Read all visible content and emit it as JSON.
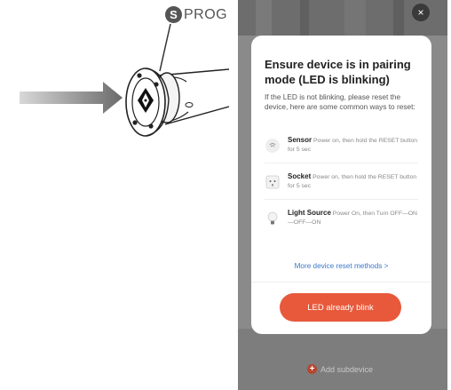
{
  "illustration": {
    "badge_letter": "S",
    "prog_label": "PROG"
  },
  "screen": {
    "close_glyph": "×",
    "add_subdevice_label": "Add subdevice"
  },
  "modal": {
    "title": "Ensure device is in pairing mode (LED is blinking)",
    "description": "If the LED is not blinking, please reset the device, here are some common ways to reset:",
    "items": [
      {
        "name": "Sensor",
        "instruction": "Power on, then hold the RESET button for 5 sec",
        "icon": "sensor-icon"
      },
      {
        "name": "Socket",
        "instruction": "Power on, then hold the RESET button for 5 sec",
        "icon": "socket-icon"
      },
      {
        "name": "Light Source",
        "instruction": "Power On, then Turn OFF—ON—OFF—ON",
        "icon": "bulb-icon"
      }
    ],
    "more_link": "More device reset methods >",
    "primary_button": "LED already blink"
  },
  "colors": {
    "accent": "#e8593b",
    "link": "#3b78c9",
    "overlay": "#8a8a8a"
  }
}
